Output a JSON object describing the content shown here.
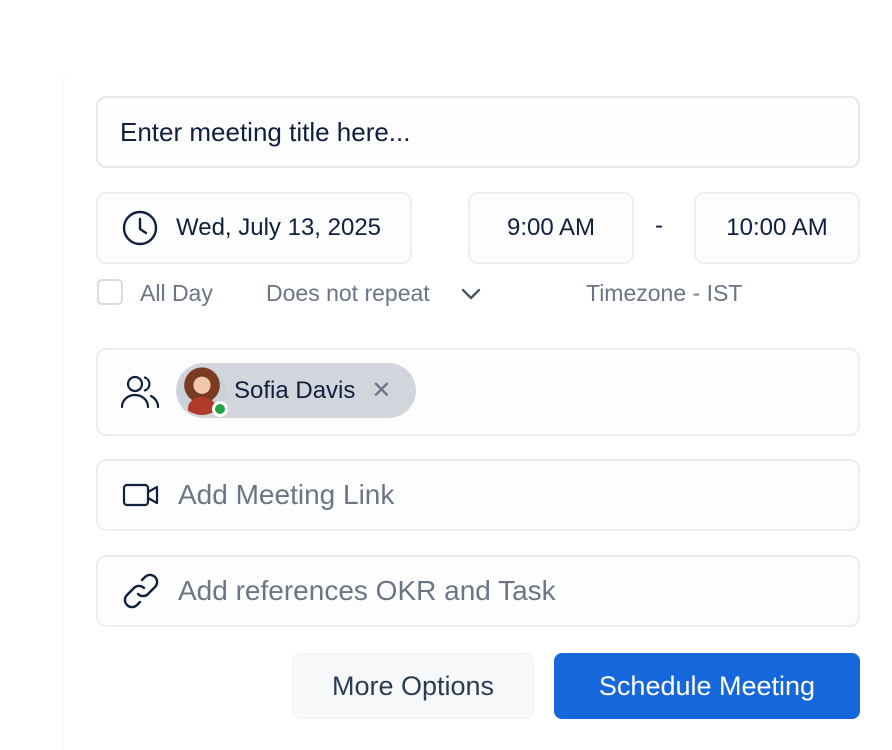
{
  "form": {
    "title_placeholder": "Enter meeting title here...",
    "date": "Wed, July 13, 2025",
    "start_time": "9:00 AM",
    "separator": "-",
    "end_time": "10:00 AM",
    "all_day_label": "All Day",
    "all_day_checked": false,
    "repeat": "Does not repeat",
    "timezone": "Timezone - IST",
    "attendees": [
      {
        "name": "Sofia Davis",
        "status": "online",
        "remove_glyph": "✕"
      }
    ],
    "meeting_link_placeholder": "Add Meeting Link",
    "references_placeholder": "Add references OKR and Task"
  },
  "actions": {
    "more_options": "More Options",
    "schedule": "Schedule Meeting"
  },
  "icons": {
    "date": "clock-icon",
    "repeat": "chevron-down-icon",
    "attendees": "users-icon",
    "link": "video-camera-icon",
    "references": "link-icon"
  },
  "colors": {
    "primary": "#1667dc",
    "text": "#0f1f3d",
    "muted": "#6b7585",
    "chip": "#d2d6dc",
    "online": "#22a447"
  }
}
